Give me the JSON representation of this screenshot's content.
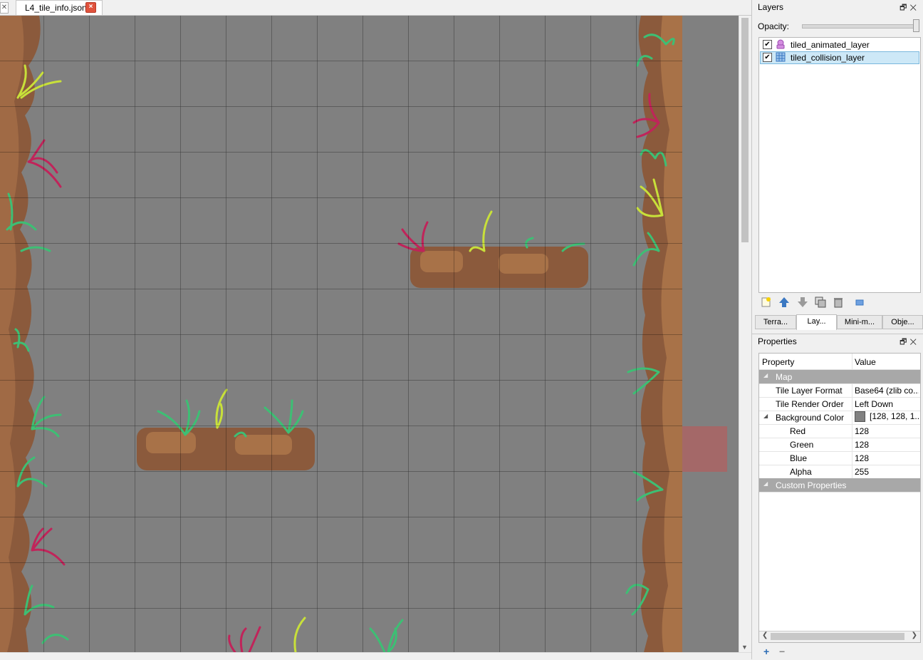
{
  "tabs": {
    "active_document": "L4_tile_info.json"
  },
  "layers_panel": {
    "title": "Layers",
    "opacity_label": "Opacity:",
    "opacity_value": 1.0,
    "layers": [
      {
        "name": "tiled_animated_layer",
        "visible": true,
        "selected": false,
        "icon": "object-layer-icon"
      },
      {
        "name": "tiled_collision_layer",
        "visible": true,
        "selected": true,
        "icon": "tile-layer-icon"
      }
    ],
    "bottom_tabs": [
      "Terra...",
      "Lay...",
      "Mini-m...",
      "Obje..."
    ],
    "active_bottom_tab": "Lay..."
  },
  "properties_panel": {
    "title": "Properties",
    "header": {
      "property": "Property",
      "value": "Value"
    },
    "sections": {
      "map": "Map",
      "custom": "Custom Properties"
    },
    "rows": {
      "tile_layer_format": {
        "key": "Tile Layer Format",
        "value": "Base64 (zlib co..."
      },
      "tile_render_order": {
        "key": "Tile Render Order",
        "value": "Left Down"
      },
      "background_color": {
        "key": "Background Color",
        "value": "[128, 128, 1..."
      },
      "red": {
        "key": "Red",
        "value": "128"
      },
      "green": {
        "key": "Green",
        "value": "128"
      },
      "blue": {
        "key": "Blue",
        "value": "128"
      },
      "alpha": {
        "key": "Alpha",
        "value": "255"
      }
    }
  },
  "colors": {
    "canvas_bg": "#808080",
    "selection_blue": "#cde8f7",
    "rock_brown": "#8b5a3c",
    "seaweed_green": "#3dbf74",
    "seaweed_yellow": "#c8e03a",
    "seaweed_magenta": "#c0245a"
  }
}
